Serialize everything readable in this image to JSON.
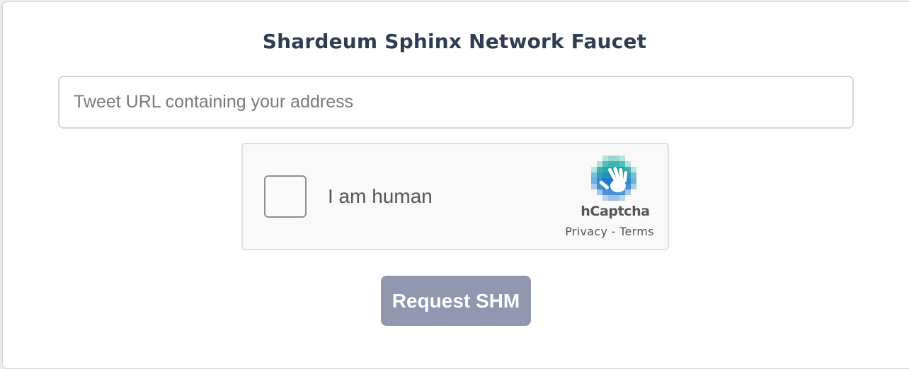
{
  "faucet": {
    "title": "Shardeum Sphinx Network Faucet",
    "tweet_input": {
      "value": "",
      "placeholder": "Tweet URL containing your address"
    },
    "captcha": {
      "label": "I am human",
      "brand": "hCaptcha",
      "privacy_link": "Privacy",
      "separator": "-",
      "terms_link": "Terms",
      "checked": false,
      "logo_icon": "hcaptcha-hand-logo"
    },
    "submit": {
      "label": "Request SHM",
      "color": "#9097ae"
    }
  }
}
